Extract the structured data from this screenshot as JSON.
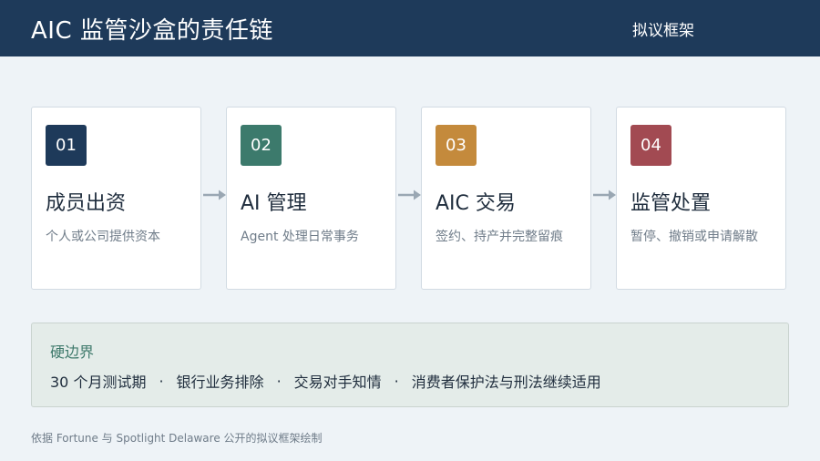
{
  "header": {
    "title": "AIC 监管沙盒的责任链",
    "tag": "拟议框架"
  },
  "steps": [
    {
      "number": "01",
      "title": "成员出资",
      "desc": "个人或公司提供资本",
      "color": "#1e3a5a"
    },
    {
      "number": "02",
      "title": "AI 管理",
      "desc": "Agent 处理日常事务",
      "color": "#3c7a6c"
    },
    {
      "number": "03",
      "title": "AIC 交易",
      "desc": "签约、持产并完整留痕",
      "color": "#c48a3c"
    },
    {
      "number": "04",
      "title": "监管处置",
      "desc": "暂停、撤销或申请解散",
      "color": "#a24a52"
    }
  ],
  "boundary": {
    "title": "硬边界",
    "items": [
      "30 个月测试期",
      "银行业务排除",
      "交易对手知情",
      "消费者保护法与刑法继续适用"
    ],
    "separator": "·"
  },
  "footnote": "依据 Fortune 与 Spotlight Delaware 公开的拟议框架绘制"
}
